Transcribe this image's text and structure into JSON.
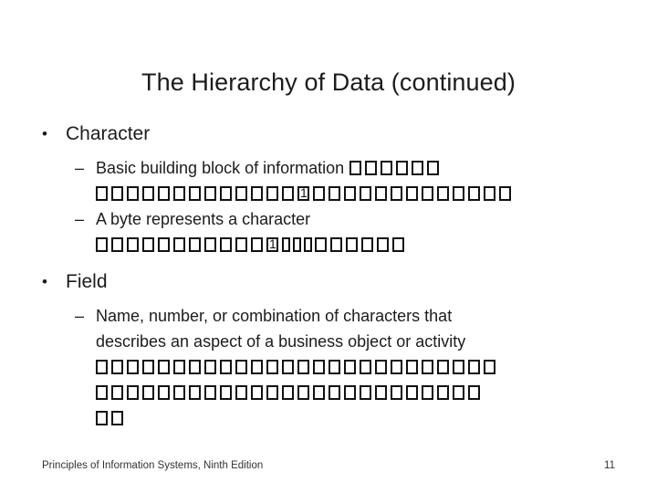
{
  "slide": {
    "title": "The Hierarchy of Data (continued)",
    "bullet_marker": "•",
    "dash_marker": "–",
    "items": [
      {
        "label": "Character",
        "sub": [
          {
            "text": "Basic building block of information",
            "trailing_boxes": 6,
            "overflow_boxes": 27,
            "overflow_digit_index": 13
          },
          {
            "text": "A byte represents a character",
            "trailing_boxes": 0,
            "overflow_boxes": 21,
            "overflow_digit_index": 11
          }
        ]
      },
      {
        "label": "Field",
        "sub": [
          {
            "text": "Name, number, or combination of characters that",
            "line2": "describes an aspect of a business object or activity",
            "overflow_boxes_row1": 26,
            "overflow_boxes_row2": 25,
            "overflow_boxes_row3": 2
          }
        ]
      }
    ]
  },
  "footer": {
    "source": "Principles of Information Systems, Ninth Edition",
    "page_number": "11"
  },
  "colors": {
    "background": "#ffffff",
    "text": "#1c1c1c",
    "footer_text": "#333333",
    "glyph_box": "#111111"
  }
}
